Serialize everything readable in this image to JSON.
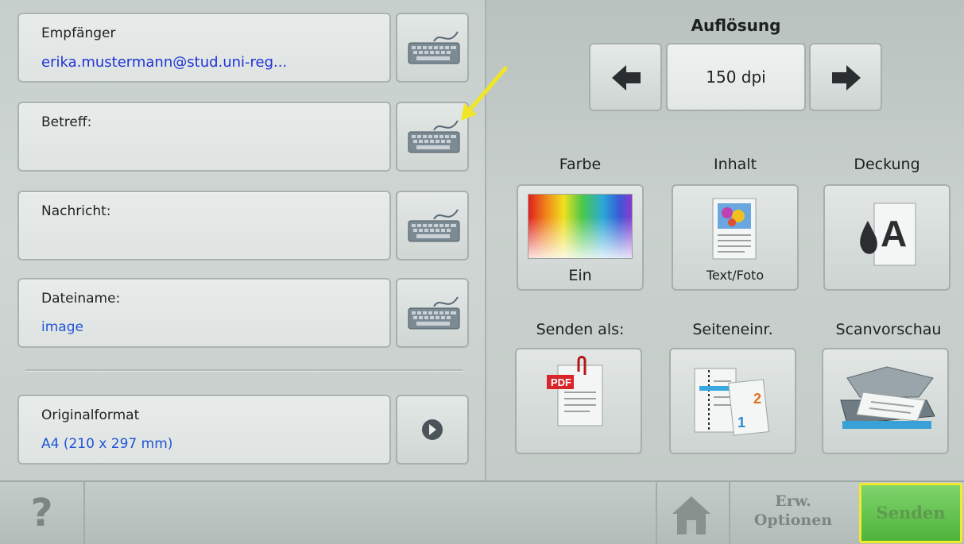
{
  "left": {
    "recipient": {
      "label": "Empfänger",
      "value": "erika.mustermann@stud.uni-reg..."
    },
    "subject": {
      "label": "Betreff:",
      "value": ""
    },
    "message": {
      "label": "Nachricht:",
      "value": ""
    },
    "filename": {
      "label": "Dateiname:",
      "value": "image"
    },
    "original_format": {
      "label": "Originalformat",
      "value": "A4 (210 x 297 mm)"
    }
  },
  "resolution": {
    "title": "Auflösung",
    "value": "150 dpi"
  },
  "tiles": {
    "color": {
      "title": "Farbe",
      "value": "Ein"
    },
    "content": {
      "title": "Inhalt",
      "value": "Text/Foto"
    },
    "coverage": {
      "title": "Deckung"
    },
    "send_as": {
      "title": "Senden als:"
    },
    "page_setup": {
      "title": "Seiteneinr."
    },
    "scan_preview": {
      "title": "Scanvorschau"
    }
  },
  "bottom": {
    "help": "?",
    "advanced_line1": "Erw.",
    "advanced_line2": "Optionen",
    "send": "Senden"
  },
  "icons": {
    "pdf": "PDF",
    "page_num_1": "1",
    "page_num_2": "2",
    "coverage_letter": "A"
  },
  "colors": {
    "send_green": "#4fb33b",
    "highlight_yellow": "#f2ea2a",
    "value_blue": "#1f33d6"
  }
}
